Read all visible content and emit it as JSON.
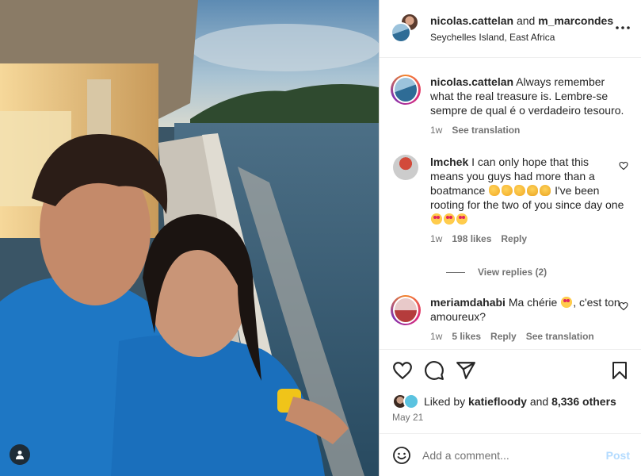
{
  "post": {
    "header": {
      "user1": "nicolas.cattelan",
      "joiner": "and",
      "user2": "m_marcondes",
      "location": "Seychelles Island, East Africa"
    },
    "comments": [
      {
        "username": "nicolas.cattelan",
        "text": "Always remember what the real treasure is. Lembre-se sempre de qual é o verdadeiro tesouro.",
        "time": "1w",
        "translate": "See translation"
      },
      {
        "username": "lmchek",
        "text_part1": "I can only hope that this means you guys had more than a boatmance",
        "text_part2": "I've been rooting for the two of you since day one",
        "time": "1w",
        "likes": "198 likes",
        "reply": "Reply",
        "view_replies": "View replies (2)"
      },
      {
        "username": "meriamdahabi",
        "text_part1": "Ma chérie",
        "text_part2": ", c'est ton amoureux?",
        "time": "1w",
        "likes": "5 likes",
        "reply": "Reply",
        "translate": "See translation"
      }
    ],
    "likes": {
      "prefix": "Liked by",
      "user": "katiefloody",
      "joiner": "and",
      "others": "8,336 others"
    },
    "date": "May 21",
    "add_comment": {
      "placeholder": "Add a comment...",
      "post_label": "Post"
    }
  },
  "icons": [
    "more-icon",
    "heart-icon",
    "comment-icon",
    "share-icon",
    "bookmark-icon",
    "emoji-icon",
    "user-tag-icon"
  ],
  "colors": {
    "text": "#262626",
    "secondary": "#737373",
    "post_disabled": "#b3dbff",
    "border": "#dbdbdb"
  }
}
